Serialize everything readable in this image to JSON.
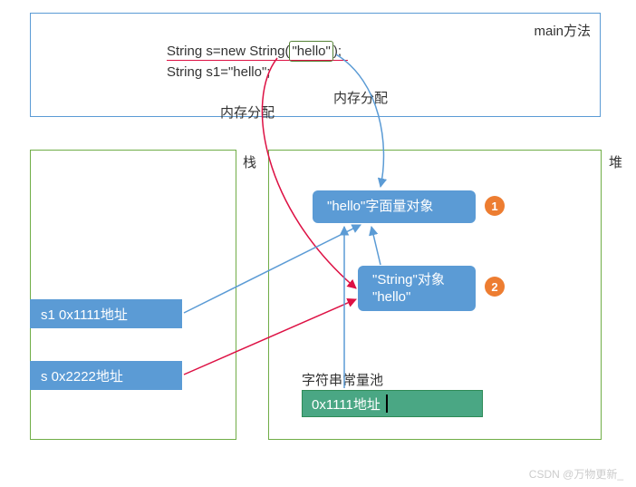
{
  "main": {
    "label": "main方法",
    "code_line1_prefix": "String s=new String(",
    "code_line1_arg": "\"hello\"",
    "code_line1_suffix": ");",
    "code_line2": "String s1=\"hello\";"
  },
  "labels": {
    "alloc_left": "内存分配",
    "alloc_right": "内存分配",
    "stack": "栈",
    "heap": "堆",
    "pool": "字符串常量池"
  },
  "stack": {
    "item1": "s1  0x1111地址",
    "item2": "s  0x2222地址"
  },
  "heap": {
    "literal_obj": "\"hello\"字面量对象",
    "string_obj_line1": "\"String\"对象",
    "string_obj_line2": "\"hello\"",
    "badge1": "1",
    "badge2": "2"
  },
  "pool": {
    "entry": "0x1111地址"
  },
  "watermark": "CSDN @万物更新_"
}
